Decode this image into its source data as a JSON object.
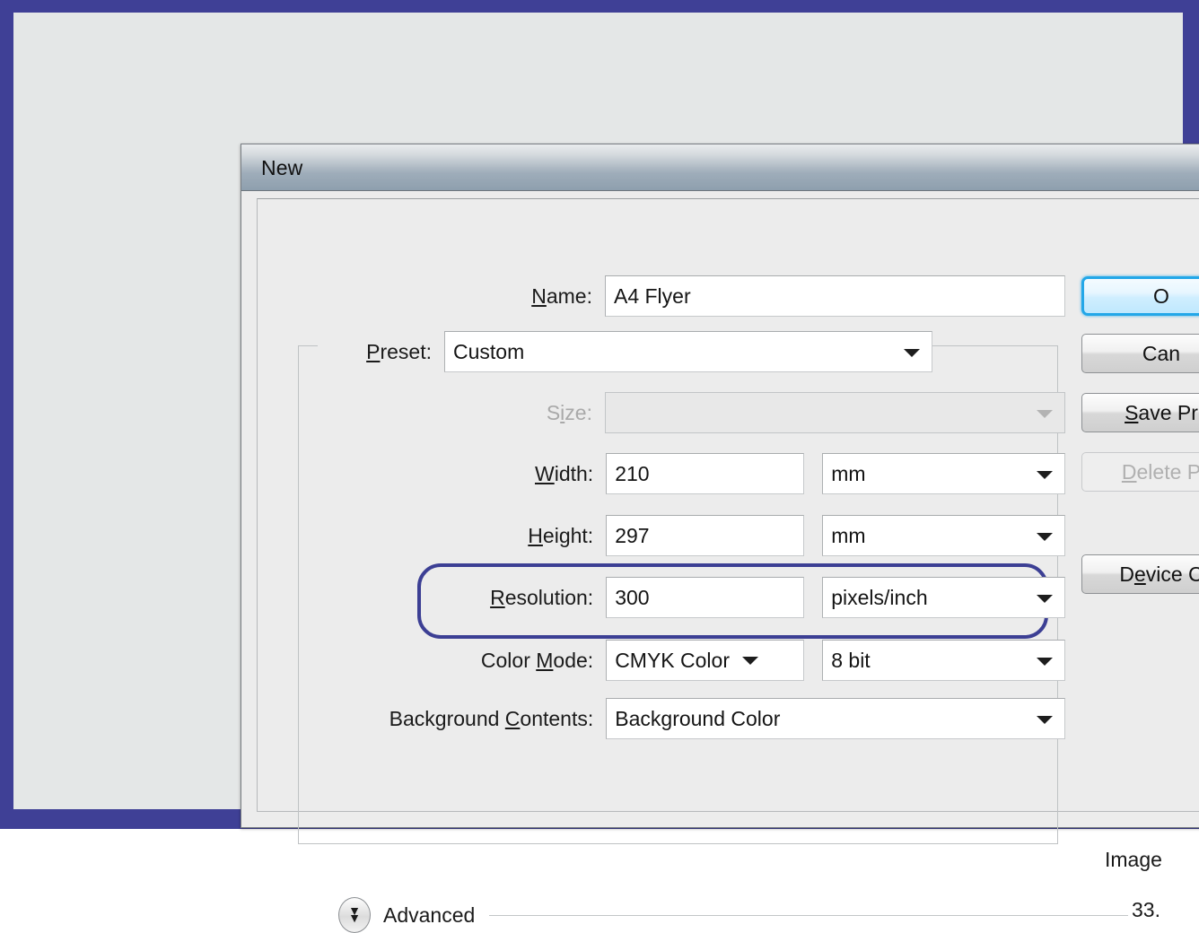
{
  "window": {
    "title": "New"
  },
  "form": {
    "name_label": "Name:",
    "name_label_accel": "N",
    "name_value": "A4 Flyer",
    "preset_label": "Preset:",
    "preset_label_accel": "P",
    "preset_value": "Custom",
    "size_label": "Size:",
    "size_label_accel": "i",
    "size_value": "",
    "width_label": "Width:",
    "width_label_accel": "W",
    "width_value": "210",
    "width_unit": "mm",
    "height_label": "Height:",
    "height_label_accel": "H",
    "height_value": "297",
    "height_unit": "mm",
    "resolution_label": "Resolution:",
    "resolution_label_accel": "R",
    "resolution_value": "300",
    "resolution_unit": "pixels/inch",
    "color_mode_label": "Color Mode:",
    "color_mode_label_accel": "M",
    "color_mode_value": "CMYK Color",
    "bit_depth_value": "8 bit",
    "background_label": "Background Contents:",
    "background_label_accel": "C",
    "background_value": "Background Color",
    "advanced_label": "Advanced",
    "advanced_icon": "double-chevron-down-icon"
  },
  "buttons": {
    "ok": "O",
    "cancel": "Can",
    "save_preset": "Save Pr",
    "save_preset_accel": "S",
    "delete_preset": "Delete P",
    "delete_preset_accel": "D",
    "device_central": "Device C",
    "device_central_accel": "e"
  },
  "info": {
    "image_size_label": "Image",
    "image_size_value": "33."
  },
  "colors": {
    "frame": "#3f4096",
    "desktop": "#e4e7e7",
    "dialog": "#ececec",
    "highlight": "#3c3f94",
    "primary_focus": "#23a7e8"
  }
}
